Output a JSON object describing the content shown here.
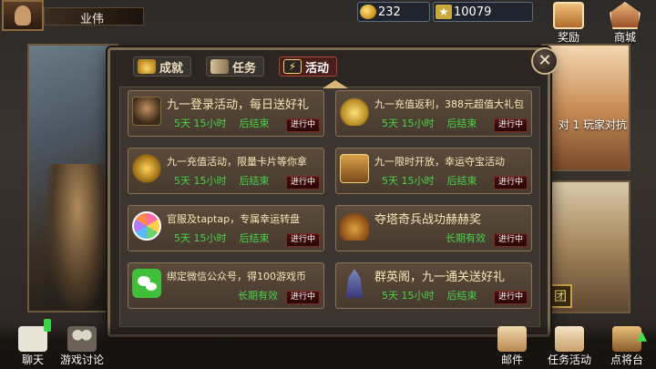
{
  "player": {
    "name": "业伟"
  },
  "resources": {
    "gold": "232",
    "gems": "10079"
  },
  "top_right": {
    "reward_label": "奖励",
    "mall_label": "商城"
  },
  "background": {
    "peek_text": "对 1 玩家对抗",
    "peek_badge": "团"
  },
  "tabs": [
    {
      "label": "成就",
      "icon": "crown-icon",
      "active": false
    },
    {
      "label": "任务",
      "icon": "scroll-icon",
      "active": false
    },
    {
      "label": "活动",
      "icon": "lightning-icon",
      "active": true
    }
  ],
  "activities": [
    {
      "title": "九一登录活动，每日送好礼",
      "days": "5天 15小时",
      "suffix": "后结束",
      "status": "进行中",
      "icon": "general-portrait-icon"
    },
    {
      "title": "九一充值返利，388元超值大礼包",
      "days": "5天 15小时",
      "suffix": "后结束",
      "status": "进行中",
      "icon": "gold-coins-icon"
    },
    {
      "title": "九一充值活动，限量卡片等你拿",
      "days": "5天 15小时",
      "suffix": "后结束",
      "status": "进行中",
      "icon": "gold-pile-icon"
    },
    {
      "title": "九一限时开放，幸运夺宝活动",
      "days": "5天 15小时",
      "suffix": "后结束",
      "status": "进行中",
      "icon": "treasure-chest-icon"
    },
    {
      "title": "官服及taptap，专属幸运转盘",
      "days": "5天 15小时",
      "suffix": "后结束",
      "status": "进行中",
      "icon": "lucky-wheel-icon"
    },
    {
      "title": "夺塔奇兵战功赫赫奖",
      "long_text": "长期有效",
      "status": "进行中",
      "icon": "treasure-pot-icon"
    },
    {
      "title": "绑定微信公众号，得100游戏币",
      "long_text": "长期有效",
      "status": "进行中",
      "icon": "wechat-icon"
    },
    {
      "title": "群英阁，九一通关送好礼",
      "days": "5天 15小时",
      "suffix": "后结束",
      "status": "进行中",
      "icon": "tower-icon"
    }
  ],
  "bottom": {
    "chat_label": "聊天",
    "discuss_label": "游戏讨论",
    "mail_label": "邮件",
    "quest_label": "任务活动",
    "general_label": "点将台"
  },
  "colors": {
    "accent_green": "#48d24a",
    "title_gold": "#f8e6b8",
    "badge_red": "#4a0e0e"
  }
}
